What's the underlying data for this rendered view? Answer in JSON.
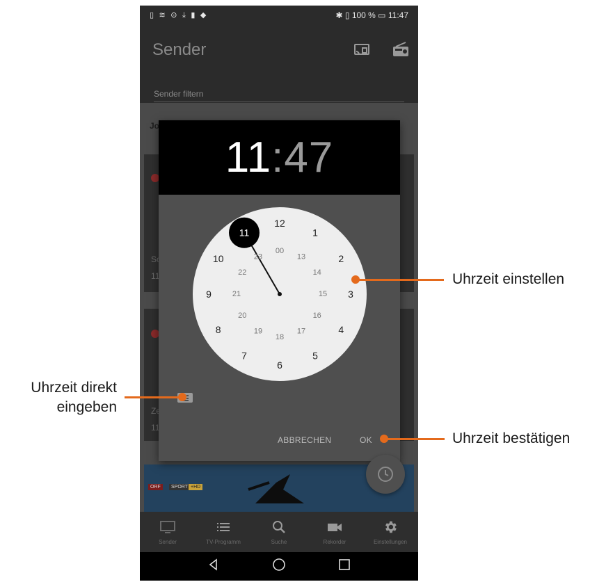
{
  "statusbar": {
    "left_icons": "▯ ≋ ⊙ ⤓ ▮ ◆",
    "right": "✱ ▯ 100 %  ▭ 11:47"
  },
  "appbar": {
    "title": "Sender",
    "filter_placeholder": "Sender filtern",
    "cast_icon": "cast-icon",
    "radio_icon": "radio-icon"
  },
  "background": {
    "section_label": "Jo",
    "card1_text_a": "So",
    "card1_text_b": "11",
    "card3_text_a": "Ze",
    "card3_text_b": "11",
    "banner_logo": "ORF",
    "banner_logo2": "SPORT",
    "banner_logo3": "+HD"
  },
  "dialog": {
    "hour": "11",
    "colon": ":",
    "minute": "47",
    "selected_hour": "11",
    "outer_hours": [
      "12",
      "1",
      "2",
      "3",
      "4",
      "5",
      "6",
      "7",
      "8",
      "9",
      "10",
      "11"
    ],
    "inner_hours": [
      "00",
      "13",
      "14",
      "15",
      "16",
      "17",
      "18",
      "19",
      "20",
      "21",
      "22",
      "23"
    ],
    "cancel_label": "ABBRECHEN",
    "ok_label": "OK",
    "keyboard_icon": "keyboard-icon"
  },
  "bottomnav": [
    {
      "label": "Sender",
      "icon": "tv-icon"
    },
    {
      "label": "TV-Programm",
      "icon": "list-icon"
    },
    {
      "label": "Suche",
      "icon": "search-icon"
    },
    {
      "label": "Rekorder",
      "icon": "video-icon"
    },
    {
      "label": "Einstellungen",
      "icon": "gear-icon"
    }
  ],
  "callouts": {
    "set_time": "Uhrzeit einstellen",
    "direct_input_line1": "Uhrzeit direkt",
    "direct_input_line2": "eingeben",
    "confirm": "Uhrzeit bestätigen"
  },
  "colors": {
    "accent": "#e46a1c",
    "dialog_header": "#000000",
    "dialog_body": "#4f4f4f",
    "clock_face": "#eeeeee"
  }
}
